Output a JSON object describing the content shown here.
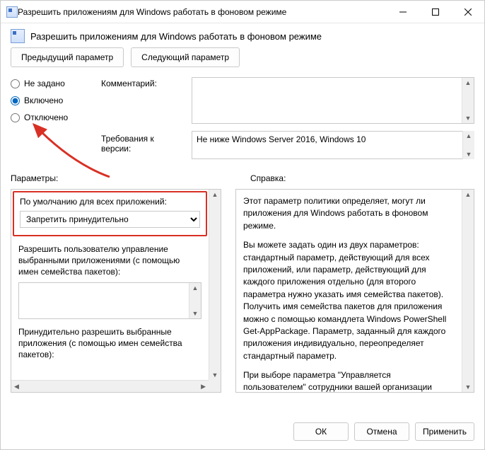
{
  "window": {
    "title": "Разрешить приложениям для Windows работать в фоновом режиме"
  },
  "subheader": {
    "title": "Разрешить приложениям для Windows работать в фоновом режиме"
  },
  "nav": {
    "prev": "Предыдущий параметр",
    "next": "Следующий параметр"
  },
  "radios": {
    "not_configured": "Не задано",
    "enabled": "Включено",
    "disabled": "Отключено",
    "selected": "enabled"
  },
  "fields": {
    "comment_label": "Комментарий:",
    "version_label": "Требования к версии:",
    "version_value": "Не ниже Windows Server 2016, Windows 10"
  },
  "sections": {
    "options": "Параметры:",
    "help": "Справка:"
  },
  "options": {
    "default_label": "По умолчанию для всех приложений:",
    "default_selected": "Запретить принудительно",
    "allow_user_label": "Разрешить пользователю управление выбранными приложениями (с помощью имен семейства пакетов):",
    "force_allow_label": "Принудительно разрешить выбранные приложения (с помощью имен семейства пакетов):"
  },
  "help": {
    "p1": "Этот параметр политики определяет, могут ли приложения для Windows работать в фоновом режиме.",
    "p2": "Вы можете задать один из двух параметров: стандартный параметр, действующий для всех приложений, или параметр, действующий для каждого приложения отдельно (для второго параметра нужно указать имя семейства пакетов). Получить имя семейства пакетов для приложения можно с помощью командлета Windows PowerShell Get-AppPackage. Параметр, заданный для каждого приложения индивидуально, переопределяет стандартный параметр.",
    "p3": "При выборе параметра \"Управляется пользователем\" сотрудники вашей организации смогут самостоятельно разрешать или запрещать приложениям для Windows работать в фоновом режиме. Для этого необходимо выбрать элементы \"Параметры\" > \"Конфиденциальность\" на устройстве."
  },
  "footer": {
    "ok": "ОК",
    "cancel": "Отмена",
    "apply": "Применить"
  }
}
